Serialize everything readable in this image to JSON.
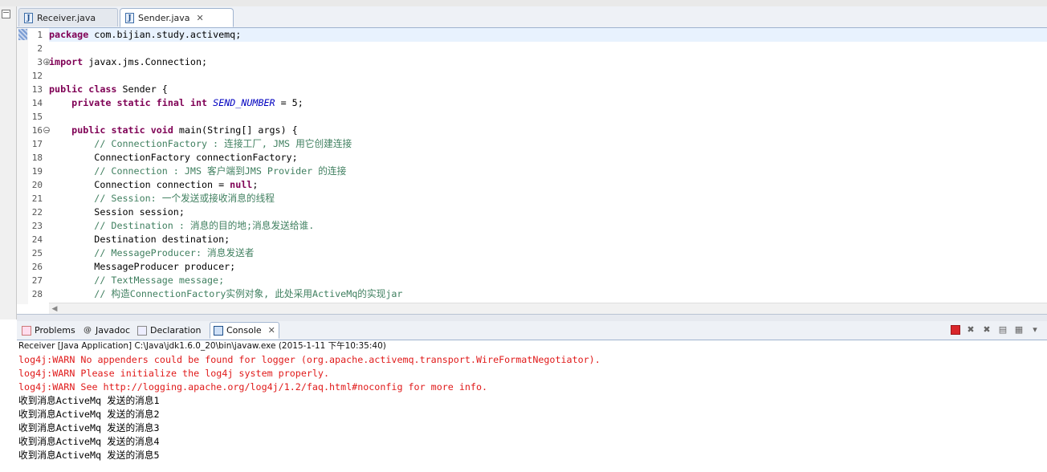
{
  "editor_tabs": [
    {
      "label": "Receiver.java",
      "active": false
    },
    {
      "label": "Sender.java",
      "active": true
    }
  ],
  "editor": {
    "lines": [
      {
        "num": "1",
        "fold": "",
        "current": true,
        "tokens": [
          {
            "t": "package",
            "c": "kw"
          },
          {
            "t": " com.bijian.study.activemq;",
            "c": ""
          }
        ]
      },
      {
        "num": "2",
        "fold": "",
        "tokens": []
      },
      {
        "num": "3",
        "fold": "+",
        "tokens": [
          {
            "t": "import",
            "c": "kw"
          },
          {
            "t": " javax.jms.Connection;",
            "c": ""
          }
        ]
      },
      {
        "num": "12",
        "fold": "",
        "tokens": []
      },
      {
        "num": "13",
        "fold": "",
        "tokens": [
          {
            "t": "public",
            "c": "kw"
          },
          {
            "t": " ",
            "c": ""
          },
          {
            "t": "class",
            "c": "kw"
          },
          {
            "t": " Sender {",
            "c": ""
          }
        ]
      },
      {
        "num": "14",
        "fold": "",
        "tokens": [
          {
            "t": "    ",
            "c": ""
          },
          {
            "t": "private",
            "c": "kw"
          },
          {
            "t": " ",
            "c": ""
          },
          {
            "t": "static",
            "c": "kw"
          },
          {
            "t": " ",
            "c": ""
          },
          {
            "t": "final",
            "c": "kw"
          },
          {
            "t": " ",
            "c": ""
          },
          {
            "t": "int",
            "c": "kw"
          },
          {
            "t": " ",
            "c": ""
          },
          {
            "t": "SEND_NUMBER",
            "c": "it"
          },
          {
            "t": " = 5;",
            "c": ""
          }
        ]
      },
      {
        "num": "15",
        "fold": "",
        "tokens": []
      },
      {
        "num": "16",
        "fold": "-",
        "tokens": [
          {
            "t": "    ",
            "c": ""
          },
          {
            "t": "public",
            "c": "kw"
          },
          {
            "t": " ",
            "c": ""
          },
          {
            "t": "static",
            "c": "kw"
          },
          {
            "t": " ",
            "c": ""
          },
          {
            "t": "void",
            "c": "kw"
          },
          {
            "t": " main(String[] args) {",
            "c": ""
          }
        ]
      },
      {
        "num": "17",
        "fold": "",
        "tokens": [
          {
            "t": "        // ConnectionFactory : 连接工厂, JMS 用它创建连接",
            "c": "cm"
          }
        ]
      },
      {
        "num": "18",
        "fold": "",
        "tokens": [
          {
            "t": "        ConnectionFactory connectionFactory;",
            "c": ""
          }
        ]
      },
      {
        "num": "19",
        "fold": "",
        "tokens": [
          {
            "t": "        // Connection : JMS 客户端到JMS Provider 的连接",
            "c": "cm"
          }
        ]
      },
      {
        "num": "20",
        "fold": "",
        "tokens": [
          {
            "t": "        Connection connection = ",
            "c": ""
          },
          {
            "t": "null",
            "c": "kw"
          },
          {
            "t": ";",
            "c": ""
          }
        ]
      },
      {
        "num": "21",
        "fold": "",
        "tokens": [
          {
            "t": "        // Session: 一个发送或接收消息的线程",
            "c": "cm"
          }
        ]
      },
      {
        "num": "22",
        "fold": "",
        "tokens": [
          {
            "t": "        Session session;",
            "c": ""
          }
        ]
      },
      {
        "num": "23",
        "fold": "",
        "tokens": [
          {
            "t": "        // Destination : 消息的目的地;消息发送给谁.",
            "c": "cm"
          }
        ]
      },
      {
        "num": "24",
        "fold": "",
        "tokens": [
          {
            "t": "        Destination destination;",
            "c": ""
          }
        ]
      },
      {
        "num": "25",
        "fold": "",
        "tokens": [
          {
            "t": "        // MessageProducer: 消息发送者",
            "c": "cm"
          }
        ]
      },
      {
        "num": "26",
        "fold": "",
        "tokens": [
          {
            "t": "        MessageProducer producer;",
            "c": ""
          }
        ]
      },
      {
        "num": "27",
        "fold": "",
        "tokens": [
          {
            "t": "        // TextMessage message;",
            "c": "cm"
          }
        ]
      },
      {
        "num": "28",
        "fold": "",
        "tokens": [
          {
            "t": "        // 构造ConnectionFactory实例对象, 此处采用ActiveMq的实现jar",
            "c": "cm"
          }
        ]
      }
    ]
  },
  "views": {
    "tabs": [
      {
        "label": "Problems",
        "icon": "problems-icon"
      },
      {
        "label": "Javadoc",
        "icon": "javadoc-icon"
      },
      {
        "label": "Declaration",
        "icon": "declaration-icon"
      },
      {
        "label": "Console",
        "icon": "console-icon",
        "active": true
      }
    ]
  },
  "console": {
    "header": "Receiver [Java Application] C:\\Java\\jdk1.6.0_20\\bin\\javaw.exe (2015-1-11 下午10:35:40)",
    "lines": [
      {
        "text": "log4j:WARN No appenders could be found for logger (org.apache.activemq.transport.WireFormatNegotiator).",
        "type": "err"
      },
      {
        "text": "log4j:WARN Please initialize the log4j system properly.",
        "type": "err"
      },
      {
        "text": "log4j:WARN See http://logging.apache.org/log4j/1.2/faq.html#noconfig for more info.",
        "type": "err"
      },
      {
        "text": "收到消息ActiveMq 发送的消息1",
        "type": "out"
      },
      {
        "text": "收到消息ActiveMq 发送的消息2",
        "type": "out"
      },
      {
        "text": "收到消息ActiveMq 发送的消息3",
        "type": "out"
      },
      {
        "text": "收到消息ActiveMq 发送的消息4",
        "type": "out"
      },
      {
        "text": "收到消息ActiveMq 发送的消息5",
        "type": "out"
      }
    ]
  },
  "colors": {
    "keyword": "#7f0055",
    "comment": "#3f7f5f",
    "constant": "#0000c0",
    "stderr": "#e01a1a"
  }
}
